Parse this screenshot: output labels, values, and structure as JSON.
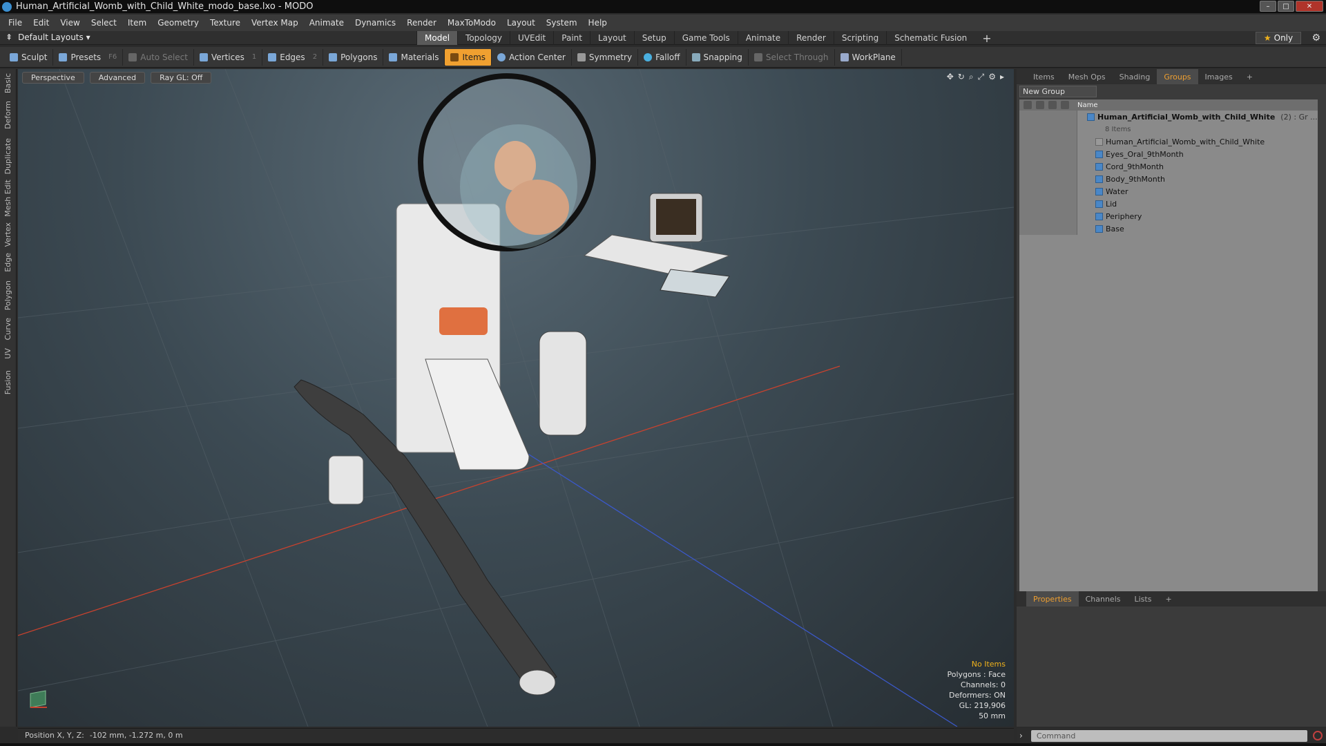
{
  "window": {
    "title": "Human_Artificial_Womb_with_Child_White_modo_base.lxo - MODO"
  },
  "menu": [
    "File",
    "Edit",
    "View",
    "Select",
    "Item",
    "Geometry",
    "Texture",
    "Vertex Map",
    "Animate",
    "Dynamics",
    "Render",
    "MaxToModo",
    "Layout",
    "System",
    "Help"
  ],
  "layout": {
    "dropdown": "Default Layouts ▾",
    "only": "Only"
  },
  "tabs": [
    {
      "label": "Model",
      "active": true
    },
    {
      "label": "Topology"
    },
    {
      "label": "UVEdit"
    },
    {
      "label": "Paint"
    },
    {
      "label": "Layout"
    },
    {
      "label": "Setup"
    },
    {
      "label": "Game Tools"
    },
    {
      "label": "Animate"
    },
    {
      "label": "Render"
    },
    {
      "label": "Scripting"
    },
    {
      "label": "Schematic Fusion"
    }
  ],
  "toolbar": {
    "sculpt": "Sculpt",
    "presets": "Presets",
    "presets_key": "F6",
    "auto_select": "Auto Select",
    "vertices": "Vertices",
    "vertices_key": "1",
    "edges": "Edges",
    "edges_key": "2",
    "polygons": "Polygons",
    "materials": "Materials",
    "items": "Items",
    "action_center": "Action Center",
    "symmetry": "Symmetry",
    "falloff": "Falloff",
    "snapping": "Snapping",
    "select_through": "Select Through",
    "workplane": "WorkPlane"
  },
  "side_tabs": [
    "Basic",
    "Deform",
    "Duplicate",
    "Mesh Edit",
    "Vertex",
    "Edge",
    "Polygon",
    "Curve",
    "UV",
    "Fusion"
  ],
  "viewport": {
    "view": "Perspective",
    "mode": "Advanced",
    "raygl": "Ray GL: Off",
    "stats": {
      "no_items": "No Items",
      "polygons": "Polygons : Face",
      "channels": "Channels: 0",
      "deformers": "Deformers: ON",
      "gl": "GL: 219,906",
      "scale": "50 mm"
    }
  },
  "status": {
    "label": "Position X, Y, Z:",
    "value": "-102 mm, -1.272 m, 0 m"
  },
  "right_panel": {
    "tabs": [
      {
        "label": "Items"
      },
      {
        "label": "Mesh Ops"
      },
      {
        "label": "Shading"
      },
      {
        "label": "Groups",
        "active": true
      },
      {
        "label": "Images"
      },
      {
        "label": "+"
      }
    ],
    "new_group": "New Group",
    "name_header": "Name",
    "group": {
      "name": "Human_Artificial_Womb_with_Child_White",
      "count": "(2) : Gr ...",
      "sub": "8 Items"
    },
    "items": [
      "Human_Artificial_Womb_with_Child_White",
      "Eyes_Oral_9thMonth",
      "Cord_9thMonth",
      "Body_9thMonth",
      "Water",
      "Lid",
      "Periphery",
      "Base"
    ]
  },
  "properties": {
    "tabs": [
      {
        "label": "Properties",
        "active": true
      },
      {
        "label": "Channels"
      },
      {
        "label": "Lists"
      },
      {
        "label": "+"
      }
    ]
  },
  "command": {
    "placeholder": "Command"
  }
}
